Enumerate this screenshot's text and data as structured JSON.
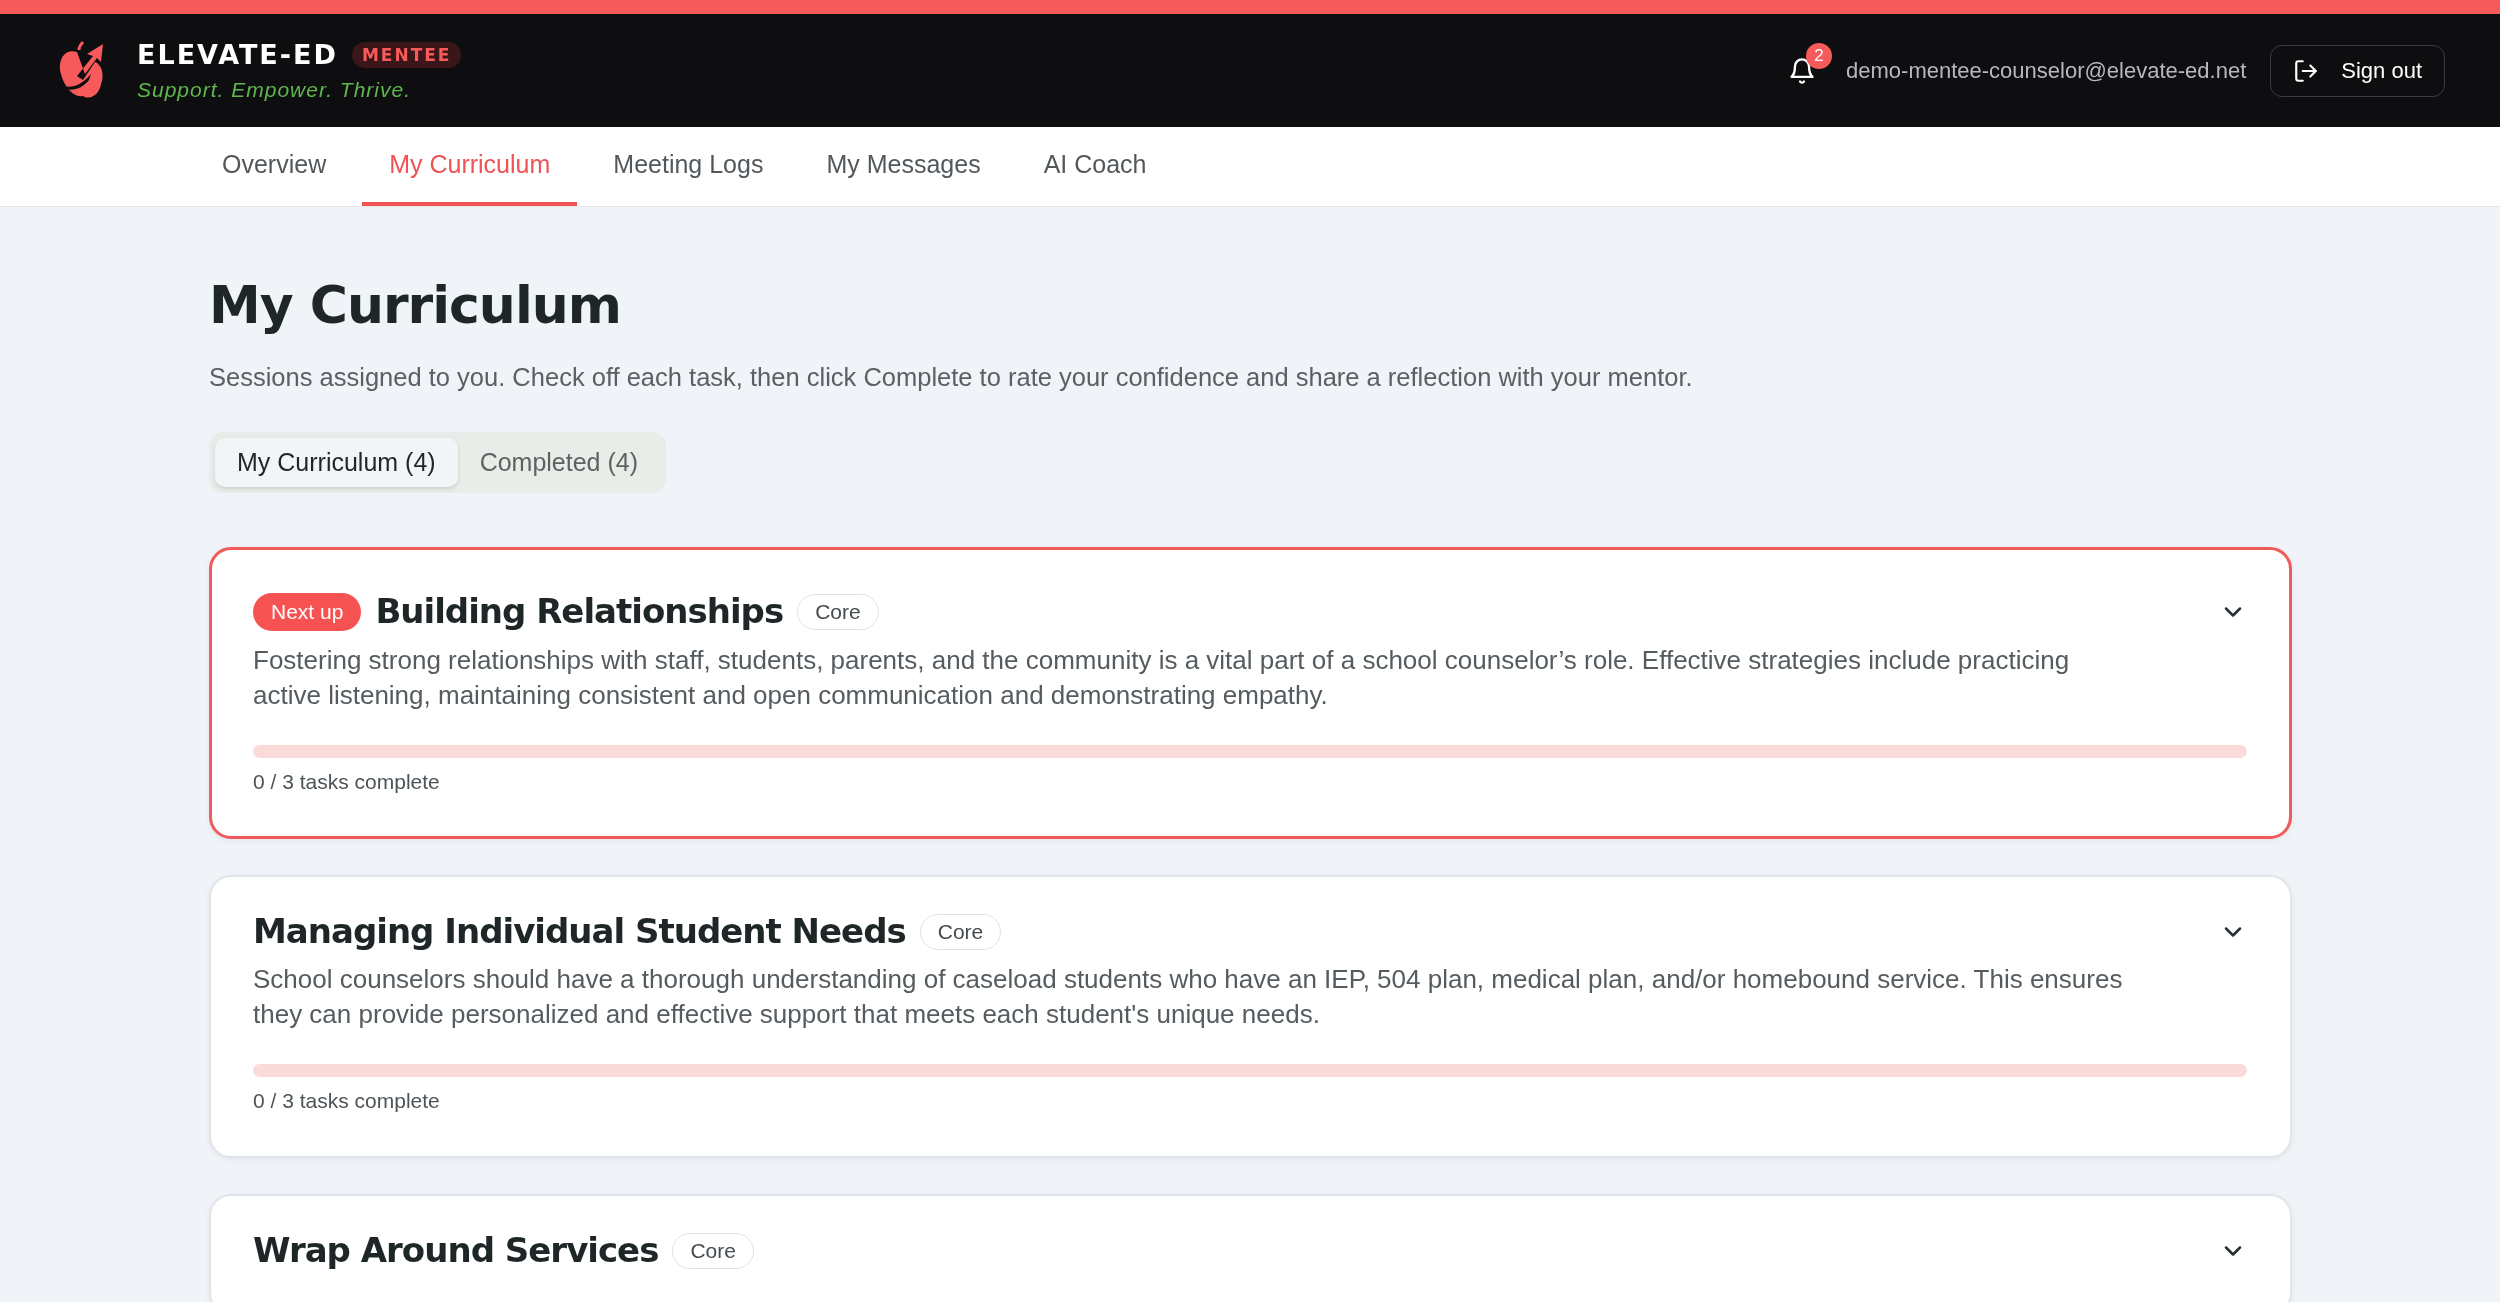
{
  "header": {
    "brand": "ELEVATE-ED",
    "role": "MENTEE",
    "tagline": "Support. Empower. Thrive.",
    "notification_count": "2",
    "email": "demo-mentee-counselor@elevate-ed.net",
    "sign_out": "Sign out"
  },
  "nav": [
    {
      "label": "Overview",
      "selected": false
    },
    {
      "label": "My Curriculum",
      "selected": true
    },
    {
      "label": "Meeting Logs",
      "selected": false
    },
    {
      "label": "My Messages",
      "selected": false
    },
    {
      "label": "AI Coach",
      "selected": false
    }
  ],
  "page": {
    "title": "My Curriculum",
    "subtitle": "Sessions assigned to you. Check off each task, then click Complete to rate your confidence and share a reflection with your mentor."
  },
  "segments": [
    {
      "label": "My Curriculum (4)",
      "selected": true
    },
    {
      "label": "Completed (4)",
      "selected": false
    }
  ],
  "sessions": [
    {
      "badge": "Next up",
      "title": "Building Relationships",
      "tag": "Core",
      "next_up": true,
      "description": "Fostering strong relationships with staff, students, parents, and the community is a vital part of a school counselor’s role. Effective strategies include practicing active listening, maintaining consistent and open communication and demonstrating empathy.",
      "level": 0,
      "progress": "0 / 3 tasks complete"
    },
    {
      "title": "Managing Individual Student Needs",
      "tag": "Core",
      "next_up": false,
      "description": "School counselors should have a thorough understanding of caseload students who have an IEP, 504 plan, medical plan, and/or homebound service. This ensures they can provide personalized and effective support that meets each student's unique needs.",
      "level": 0,
      "progress": "0 / 3 tasks complete"
    },
    {
      "title": "Wrap Around Services",
      "tag": "Core",
      "next_up": false
    }
  ]
}
